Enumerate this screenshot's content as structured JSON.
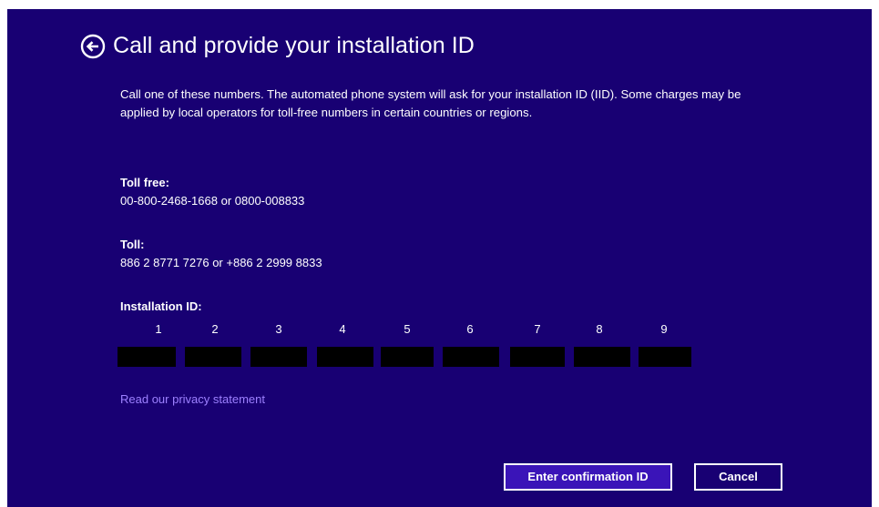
{
  "page": {
    "title": "Call and provide your installation ID",
    "description": "Call one of these numbers. The automated phone system will ask for your installation ID (IID). Some charges may be applied by local operators for toll-free numbers in certain countries or regions."
  },
  "toll_free": {
    "label": "Toll free:",
    "numbers": "00-800-2468-1668 or 0800-008833"
  },
  "toll": {
    "label": "Toll:",
    "numbers": "886 2 8771 7276 or +886 2 2999 8833"
  },
  "installation_id": {
    "label": "Installation ID:",
    "groups": [
      "1",
      "2",
      "3",
      "4",
      "5",
      "6",
      "7",
      "8",
      "9"
    ],
    "values_redacted": true
  },
  "links": {
    "privacy": "Read our privacy statement"
  },
  "buttons": {
    "enter_confirmation": "Enter confirmation ID",
    "cancel": "Cancel"
  },
  "colors": {
    "background": "#180073",
    "text": "#ffffff",
    "link": "#9d80ff",
    "redaction": "#000000"
  },
  "icons": {
    "back": "back-arrow-circle-icon"
  }
}
